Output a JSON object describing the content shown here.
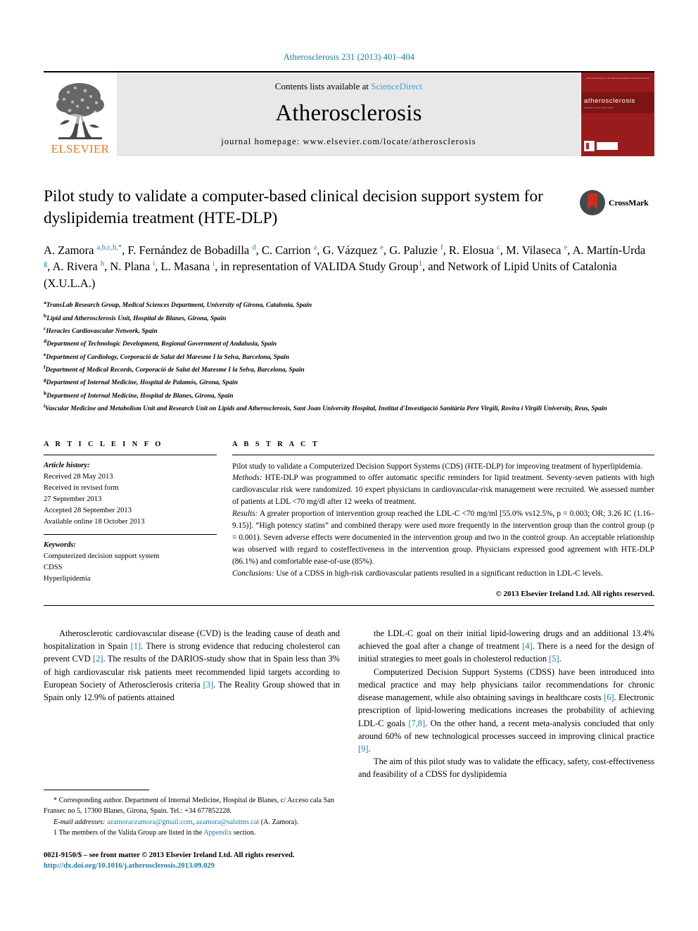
{
  "running_head": "Atherosclerosis 231 (2013) 401–404",
  "masthead": {
    "publisher": "ELSEVIER",
    "contents_prefix": "Contents lists available at ",
    "contents_link": "ScienceDirect",
    "journal_name": "Atherosclerosis",
    "homepage": "journal homepage: www.elsevier.com/locate/atherosclerosis",
    "cover": {
      "top_text": "Oficial journal of the European Atherosclerosis Society",
      "title": "atherosclerosis",
      "subtitle": "Including coronary artery disease"
    }
  },
  "crossmark": {
    "label": "CrossMark"
  },
  "article": {
    "title": "Pilot study to validate a computer-based clinical decision support system for dyslipidemia treatment (HTE-DLP)",
    "authors_html": "A. Zamora <sup>a,b,c,h,*</sup>, F. Fernández de Bobadilla <sup>d</sup>, C. Carrion <sup>a</sup>, G. Vázquez <sup>e</sup>, G. Paluzie <sup>f</sup>, R. Elosua <sup>c</sup>, M. Vilaseca <sup>e</sup>, A. Martín-Urda <sup>g</sup>, A. Rivera <sup>h</sup>, N. Plana <sup>i</sup>, L. Masana <sup>i</sup>, in representation of VALIDA Study Group<sup>1</sup>, and Network of Lipid Units of Catalonia (X.U.L.A.)",
    "affiliations": [
      {
        "mark": "a",
        "text": "TransLab Research Group, Medical Sciences Department, University of Girona, Catalonia, Spain"
      },
      {
        "mark": "b",
        "text": "Lipid and Atherosclerosis Unit, Hospital de Blanes, Girona, Spain"
      },
      {
        "mark": "c",
        "text": "Heracles Cardiovascular Network, Spain"
      },
      {
        "mark": "d",
        "text": "Department of Technologic Development, Regional Government of Andalusia, Spain"
      },
      {
        "mark": "e",
        "text": "Department of Cardiology, Corporació de Salut del Maresme I la Selva, Barcelona, Spain"
      },
      {
        "mark": "f",
        "text": "Department of Medical Records, Corporació de Salut del Maresme I la Selva, Barcelona, Spain"
      },
      {
        "mark": "g",
        "text": "Department of Internal Medicine, Hospital de Palamós, Girona, Spain"
      },
      {
        "mark": "h",
        "text": "Department of Internal Medicine, Hospital de Blanes, Girona, Spain"
      },
      {
        "mark": "i",
        "text": "Vascular Medicine and Metabolism Unit and Research Unit on Lipids and Atherosclerosis, Sant Joan University Hospital, Institut d'Investigació Sanitària Pere Virgili, Rovira i Virgili University, Reus, Spain"
      }
    ]
  },
  "article_info": {
    "heading": "A R T I C L E   I N F O",
    "history_label": "Article history:",
    "history_lines": [
      "Received 28 May 2013",
      "Received in revised form",
      "27 September 2013",
      "Accepted 28 September 2013",
      "Available online 18 October 2013"
    ],
    "keywords_label": "Keywords:",
    "keywords": [
      "Computerized decision support system",
      "CDSS",
      "Hyperlipidemia"
    ]
  },
  "abstract": {
    "heading": "A B S T R A C T",
    "intro": "Pilot study to validate a Computerized Decision Support Systems (CDS) (HTE-DLP) for improving treatment of hyperlipidemia.",
    "methods_label": "Methods:",
    "methods": " HTE-DLP was programmed to offer automatic specific reminders for lipid treatment. Seventy-seven patients with high cardiovascular risk were randomized. 10 expert physicians in cardiovascular-risk management were recruited. We assessed number of patients at LDL <70 mg/dl after 12 weeks of treatment.",
    "results_label": "Results:",
    "results": " A greater proportion of intervention group reached the LDL-C <70 mg/ml [55.0% vs12.5%, p = 0.003; OR; 3.26 IC (1.16–9.15)]. “High potency statins” and combined therapy were used more frequently in the intervention group than the control group (p = 0.001). Seven adverse effects were documented in the intervention group and two in the control group. An acceptable relationship was observed with regard to costeffectiveness in the intervention group. Physicians expressed good agreement with HTE-DLP (86.1%) and comfortable ease-of-use (85%).",
    "conclusions_label": "Conclusions:",
    "conclusions": " Use of a CDSS in high-risk cardiovascular patients resulted in a significant reduction in LDL-C levels.",
    "copyright": "© 2013 Elsevier Ireland Ltd. All rights reserved."
  },
  "body": {
    "left_column_html": "Atherosclerotic cardiovascular disease (CVD) is the leading cause of death and hospitalization in Spain <span class=\"ref\">[1]</span>. There is strong evidence that reducing cholesterol can prevent CVD <span class=\"ref\">[2]</span>. The results of the DARIOS-study show that in Spain less than 3% of high cardiovascular risk patients meet recommended lipid targets according to European Society of Atherosclerosis criteria <span class=\"ref\">[3]</span>. The Reality Group showed that in Spain only 12.9% of patients attained",
    "right_column_html": "the LDL-C goal on their initial lipid-lowering drugs and an additional 13.4% achieved the goal after a change of treatment <span class=\"ref\">[4]</span>. There is a need for the design of initial strategies to meet goals in cholesterol reduction <span class=\"ref\">[5]</span>.|Computerized Decision Support Systems (CDSS) have been introduced into medical practice and may help physicians tailor recommendations for chronic disease management, while also obtaining savings in healthcare costs <span class=\"ref\">[6]</span>. Electronic prescription of lipid-lowering medications increases the probability of achieving LDL-C goals <span class=\"ref\">[7,8]</span>. On the other hand, a recent meta-analysis concluded that only around 60% of new technological processes succeed in improving clinical practice <span class=\"ref\">[9]</span>.|The aim of this pilot study was to validate the efficacy, safety, cost-effectiveness and feasibility of a CDSS for dyslipidemia"
  },
  "footnote": {
    "corresponding_html": "* Corresponding author. Department of Internal Medicine, Hospital de Blanes, c/ Acceso cala San Fransec no 5, 17300 Blanes, Girona, Spain. Tel.: +34 677852228.",
    "email_label": "E-mail addresses:",
    "email1": "azamoraczamora@gmail.com",
    "email2": "azamora@salutms.cat",
    "email_suffix": "(A. Zamora).",
    "valida_prefix": "1  The members of the Valida Group are listed in the ",
    "valida_link": "Appendix",
    "valida_suffix": " section."
  },
  "page_footer": {
    "issn_line": "0021-9150/$ – see front matter © 2013 Elsevier Ireland Ltd. All rights reserved.",
    "doi": "http://dx.doi.org/10.1016/j.atherosclerosis.2013.09.029"
  }
}
